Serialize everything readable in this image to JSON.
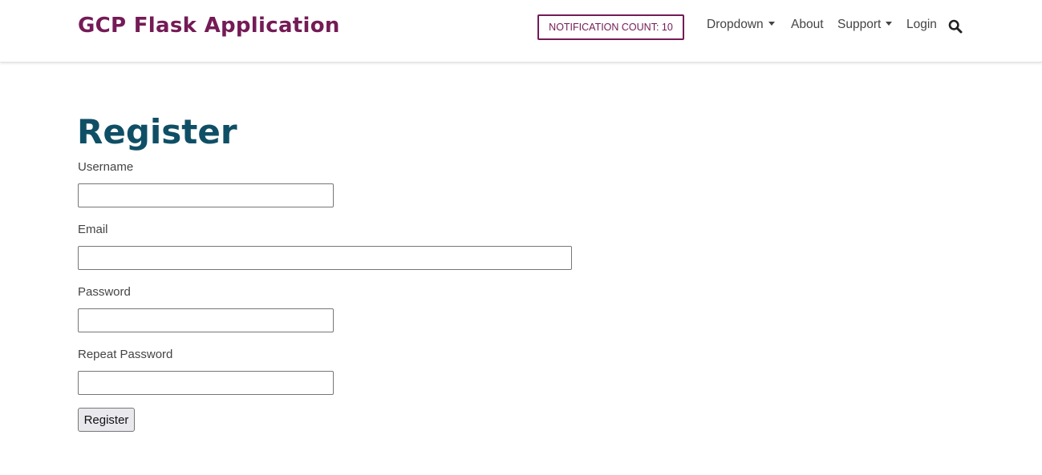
{
  "header": {
    "brand": "GCP Flask Application",
    "notification_label": "NOTIFICATION COUNT: 10",
    "nav": {
      "dropdown": "Dropdown",
      "about": "About",
      "support": "Support",
      "login": "Login"
    },
    "search_icon": "search-icon"
  },
  "main": {
    "title": "Register",
    "fields": {
      "username": {
        "label": "Username",
        "value": ""
      },
      "email": {
        "label": "Email",
        "value": ""
      },
      "password": {
        "label": "Password",
        "value": ""
      },
      "repeat_password": {
        "label": "Repeat Password",
        "value": ""
      }
    },
    "submit_label": "Register"
  },
  "colors": {
    "brand": "#741b56",
    "title": "#0f4f66",
    "text": "#444444"
  }
}
